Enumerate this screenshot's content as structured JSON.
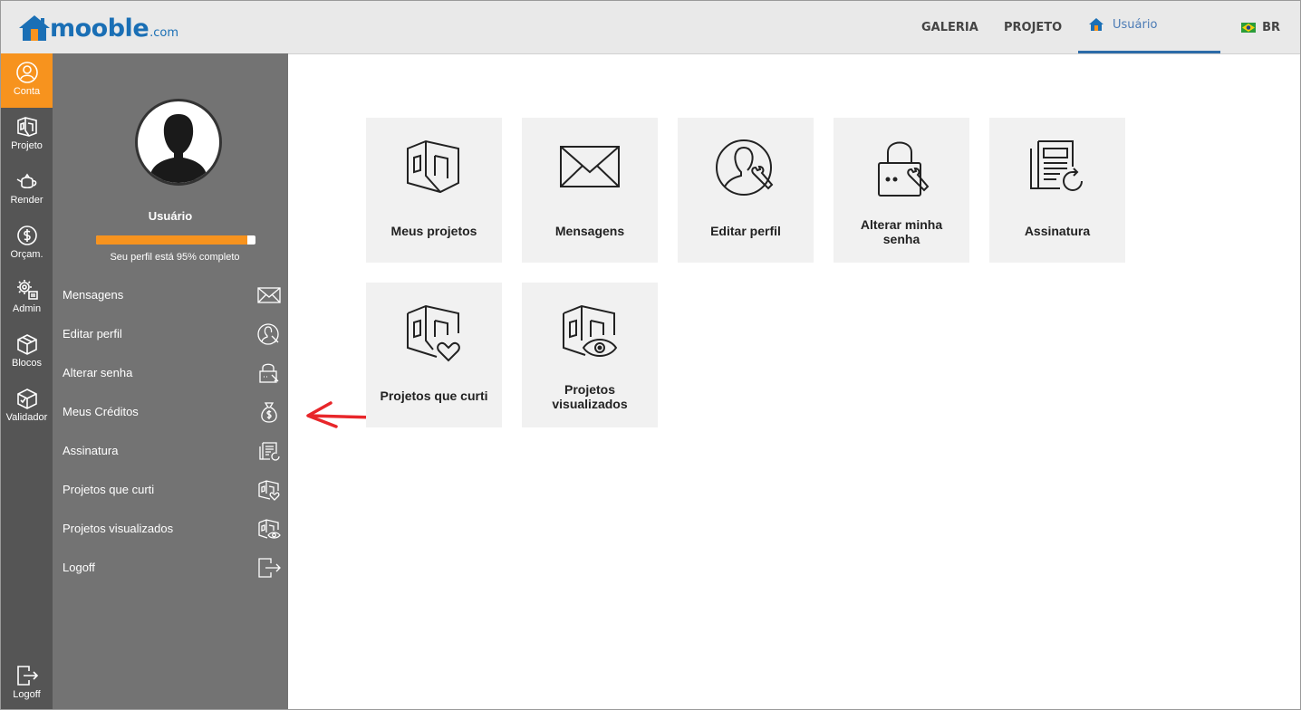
{
  "brand": {
    "name": "mooble",
    "domain": ".com",
    "color": "#1a6fb5"
  },
  "topnav": {
    "items": [
      {
        "label": "GALERIA"
      },
      {
        "label": "PROJETO"
      },
      {
        "label": "Usuário",
        "active": true
      }
    ],
    "language": "BR"
  },
  "strip": {
    "items": [
      {
        "label": "Conta",
        "icon": "user-circle-icon",
        "active": true
      },
      {
        "label": "Projeto",
        "icon": "cube-project-icon"
      },
      {
        "label": "Render",
        "icon": "teapot-icon"
      },
      {
        "label": "Orçam.",
        "icon": "dollar-coin-icon"
      },
      {
        "label": "Admin",
        "icon": "gears-icon"
      },
      {
        "label": "Blocos",
        "icon": "box-icon"
      },
      {
        "label": "Validador",
        "icon": "box-check-icon"
      }
    ],
    "logoff_label": "Logoff"
  },
  "profile": {
    "name": "Usuário",
    "completion": 95,
    "completion_text": "Seu perfil está 95% completo"
  },
  "menu": {
    "items": [
      {
        "label": "Mensagens",
        "icon": "envelope-icon"
      },
      {
        "label": "Editar perfil",
        "icon": "user-edit-icon"
      },
      {
        "label": "Alterar senha",
        "icon": "lock-key-icon"
      },
      {
        "label": "Meus Créditos",
        "icon": "money-bag-icon"
      },
      {
        "label": "Assinatura",
        "icon": "newspaper-refresh-icon"
      },
      {
        "label": "Projetos que curti",
        "icon": "cube-heart-icon"
      },
      {
        "label": "Projetos visualizados",
        "icon": "cube-eye-icon"
      },
      {
        "label": "Logoff",
        "icon": "logout-icon"
      }
    ]
  },
  "tiles": [
    {
      "label": "Meus projetos",
      "icon": "cube-project-icon"
    },
    {
      "label": "Mensagens",
      "icon": "envelope-icon"
    },
    {
      "label": "Editar perfil",
      "icon": "user-edit-icon"
    },
    {
      "label_line1": "Alterar minha",
      "label_line2": "senha",
      "icon": "lock-key-icon"
    },
    {
      "label": "Assinatura",
      "icon": "newspaper-refresh-icon"
    },
    {
      "label": "Projetos que curti",
      "icon": "cube-heart-icon"
    },
    {
      "label_line1": "Projetos",
      "label_line2": "visualizados",
      "icon": "cube-eye-icon"
    }
  ],
  "colors": {
    "accent": "#f7931e",
    "strip": "#555555",
    "panel": "#737373",
    "tile": "#f1f1f1",
    "annotation_arrow": "#e8262a"
  }
}
